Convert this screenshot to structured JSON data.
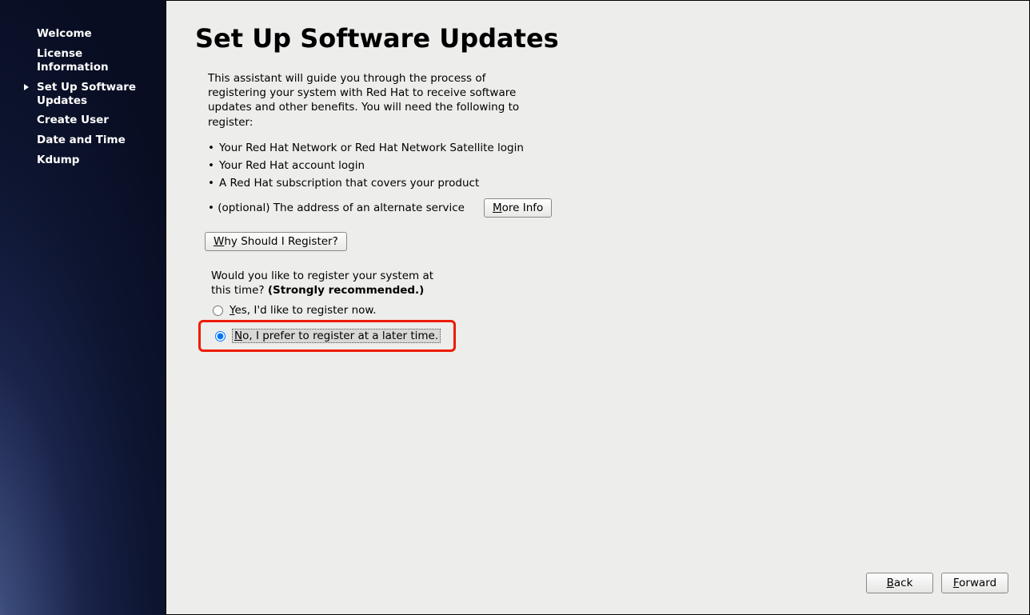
{
  "sidebar": {
    "items": [
      {
        "label": "Welcome"
      },
      {
        "label": "License Information"
      },
      {
        "label": "Set Up Software Updates"
      },
      {
        "label": "Create User"
      },
      {
        "label": "Date and Time"
      },
      {
        "label": "Kdump"
      }
    ],
    "active_index": 2
  },
  "page": {
    "title": "Set Up Software Updates",
    "intro": "This assistant will guide you through the process of registering your system with Red Hat to receive software updates and other benefits. You will need the following to register:",
    "requirements": [
      "Your Red Hat Network or Red Hat Network Satellite login",
      "Your Red Hat account login",
      "A Red Hat subscription that covers your product"
    ],
    "optional_req": "(optional) The address of an alternate service",
    "more_info_btn": {
      "prefix": "M",
      "rest": "ore Info"
    },
    "why_btn": {
      "prefix": "W",
      "rest": "hy Should I Register?"
    },
    "prompt_q": "Would you like to register your system at this time? ",
    "prompt_strong": "(Strongly recommended.)",
    "radio_yes": {
      "prefix": "Y",
      "rest": "es, I'd like to register now."
    },
    "radio_no": {
      "prefix": "N",
      "rest": "o, I prefer to register at a later time."
    }
  },
  "footer": {
    "back": {
      "prefix": "B",
      "rest": "ack"
    },
    "forward": {
      "prefix": "F",
      "rest": "orward"
    }
  }
}
